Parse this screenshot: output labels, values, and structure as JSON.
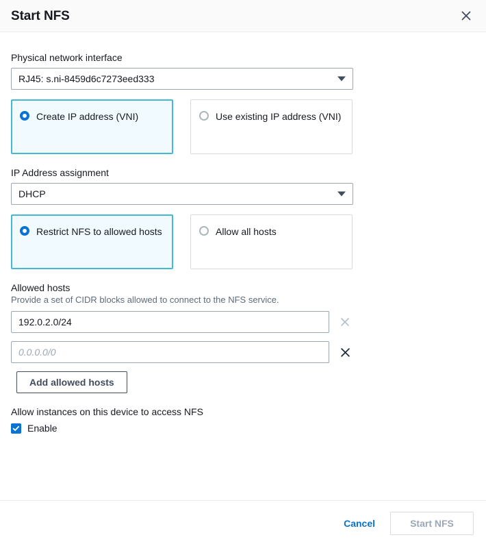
{
  "dialog": {
    "title": "Start NFS",
    "close_icon": "close-icon"
  },
  "physical_interface": {
    "label": "Physical network interface",
    "selected": "RJ45: s.ni-8459d6c7273eed333"
  },
  "ip_mode": {
    "options": [
      {
        "label": "Create IP address (VNI)",
        "selected": true
      },
      {
        "label": "Use existing IP address (VNI)",
        "selected": false
      }
    ]
  },
  "ip_assignment": {
    "label": "IP Address assignment",
    "selected": "DHCP"
  },
  "host_mode": {
    "options": [
      {
        "label": "Restrict NFS to allowed hosts",
        "selected": true
      },
      {
        "label": "Allow all hosts",
        "selected": false
      }
    ]
  },
  "allowed_hosts": {
    "label": "Allowed hosts",
    "description": "Provide a set of CIDR blocks allowed to connect to the NFS service.",
    "rows": [
      {
        "value": "192.0.2.0/24",
        "placeholder": "",
        "remove_enabled": false
      },
      {
        "value": "",
        "placeholder": "0.0.0.0/0",
        "remove_enabled": true
      }
    ],
    "add_button": "Add allowed hosts"
  },
  "instance_access": {
    "label": "Allow instances on this device to access NFS",
    "checkbox_label": "Enable",
    "checked": true
  },
  "footer": {
    "cancel_label": "Cancel",
    "submit_label": "Start NFS",
    "submit_disabled": true
  },
  "colors": {
    "accent": "#0972d3",
    "selected_tile_bg": "#f1faff",
    "selected_tile_border": "#44b9d6",
    "text": "#16191f",
    "muted": "#5f6b7a"
  }
}
